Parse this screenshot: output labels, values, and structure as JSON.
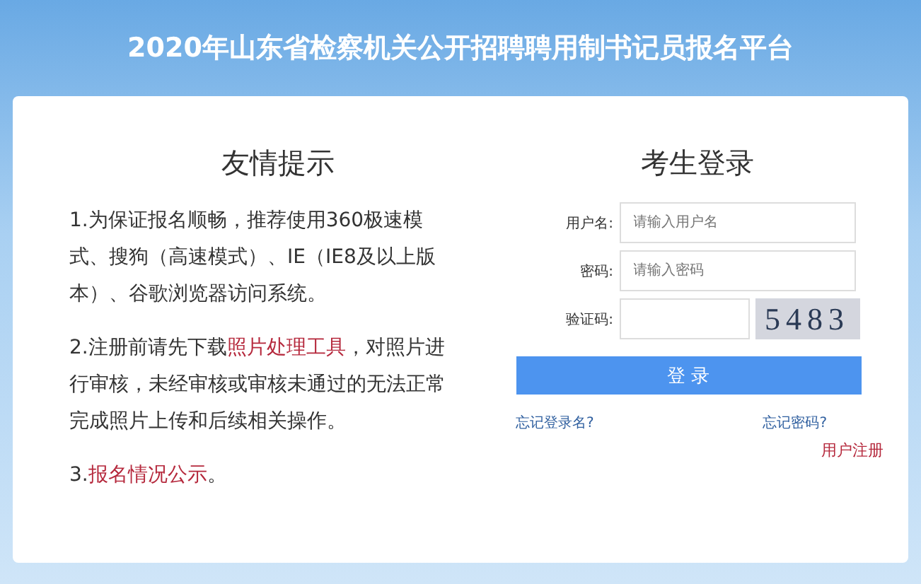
{
  "header": {
    "title": "2020年山东省检察机关公开招聘聘用制书记员报名平台"
  },
  "notice": {
    "heading": "友情提示",
    "paragraphs": [
      [
        {
          "kind": "text",
          "text": "1.为保证报名顺畅，推荐使用360极速模式、搜狗（高速模式）、IE（IE8及以上版本）、谷歌浏览器访问系统。"
        }
      ],
      [
        {
          "kind": "text",
          "text": "2.注册前请先下载"
        },
        {
          "kind": "link",
          "text": "照片处理工具"
        },
        {
          "kind": "text",
          "text": "，对照片进行审核，未经审核或审核未通过的无法正常完成照片上传和后续相关操作。"
        }
      ],
      [
        {
          "kind": "text",
          "text": "3."
        },
        {
          "kind": "link",
          "text": "报名情况公示"
        },
        {
          "kind": "text",
          "text": "。"
        }
      ]
    ]
  },
  "login": {
    "heading": "考生登录",
    "fields": [
      {
        "kind": "text",
        "label": "用户名:",
        "placeholder": "请输入用户名"
      },
      {
        "kind": "text",
        "label": "密码:",
        "placeholder": "请输入密码"
      },
      {
        "kind": "captcha",
        "label": "验证码:",
        "captcha": "5483"
      }
    ],
    "submit": "登 录",
    "forgot_username": "忘记登录名?",
    "forgot_password": "忘记密码?",
    "register": "用户注册"
  }
}
